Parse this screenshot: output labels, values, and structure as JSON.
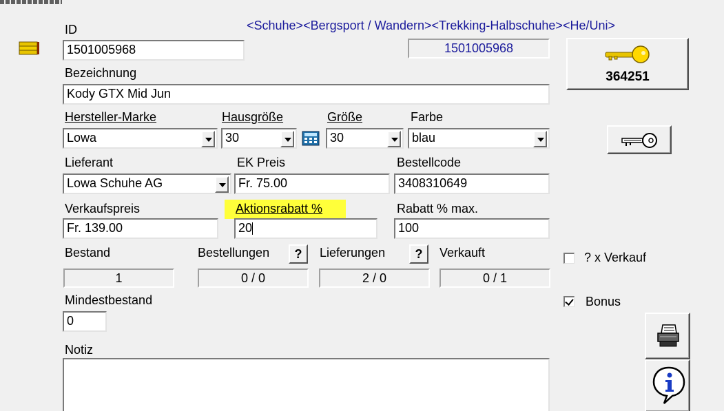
{
  "category_path": "<Schuhe><Bergsport / Wandern><Trekking-Halbschuhe><He/Uni>",
  "fields": {
    "id_label": "ID",
    "id_value": "1501005968",
    "id_readonly": "1501005968",
    "bezeichnung_label": "Bezeichnung",
    "bezeichnung_value": "Kody GTX Mid Jun",
    "hersteller_label": "Hersteller-Marke",
    "hersteller_value": "Lowa",
    "hausgroesse_label": "Hausgröße",
    "hausgroesse_value": "30",
    "groesse_label": "Größe",
    "groesse_value": "30",
    "farbe_label": "Farbe",
    "farbe_value": "blau",
    "lieferant_label": "Lieferant",
    "lieferant_value": "Lowa Schuhe AG",
    "ek_preis_label": "EK Preis",
    "ek_preis_value": "Fr. 75.00",
    "bestellcode_label": "Bestellcode",
    "bestellcode_value": "3408310649",
    "verkaufspreis_label": "Verkaufspreis",
    "verkaufspreis_value": "Fr. 139.00",
    "aktionsrabatt_label": "Aktionsrabatt %",
    "aktionsrabatt_value": "20",
    "rabatt_max_label": "Rabatt % max.",
    "rabatt_max_value": "100",
    "bestand_label": "Bestand",
    "bestand_value": "1",
    "bestellungen_label": "Bestellungen",
    "bestellungen_value": "0 / 0",
    "lieferungen_label": "Lieferungen",
    "lieferungen_value": "2 / 0",
    "verkauft_label": "Verkauft",
    "verkauft_value": "0 / 1",
    "mindestbestand_label": "Mindestbestand",
    "mindestbestand_value": "0",
    "notiz_label": "Notiz",
    "notiz_value": ""
  },
  "buttons": {
    "key_number": "364251",
    "help_glyph": "?"
  },
  "checkboxes": {
    "verkauf_label": "? x Verkauf",
    "verkauf_checked": false,
    "bonus_label": "Bonus",
    "bonus_checked": true
  },
  "colors": {
    "highlight": "#ffff3a",
    "category_text": "#1c1c9c",
    "key_gold": "#e8c400"
  }
}
